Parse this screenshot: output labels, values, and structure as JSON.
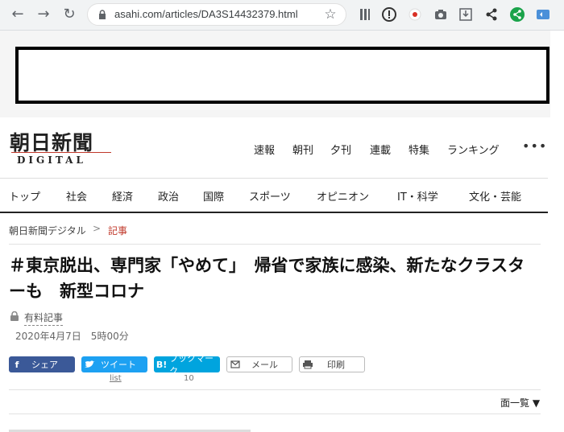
{
  "browser": {
    "url": "asahi.com/articles/DA3S14432379.html",
    "back_icon": "←",
    "forward_icon": "→",
    "reload_icon": "↻",
    "star_icon": "☆"
  },
  "site": {
    "logo_jp": "朝日新聞",
    "logo_en": "DIGITAL",
    "top_nav": [
      "速報",
      "朝刊",
      "夕刊",
      "連載",
      "特集",
      "ランキング"
    ],
    "more_icon": "•••",
    "categories": [
      "トップ",
      "社会",
      "経済",
      "政治",
      "国際",
      "スポーツ",
      "オピニオン",
      "IT・科学",
      "文化・芸能"
    ]
  },
  "breadcrumb": {
    "home": "朝日新聞デジタル",
    "separator": ">",
    "current": "記事"
  },
  "article": {
    "headline": "＃東京脱出、専門家「やめて」　帰省で家族に感染、新たなクラスターも　新型コロナ",
    "paid_label": "有料記事",
    "date": "2020年4月7日　5時00分"
  },
  "share": {
    "share_label": "シェア",
    "share_icon": "f",
    "tweet_label": "ツイート",
    "tweet_count": "list",
    "hatena_label": "ブックマーク",
    "hatena_icon": "B!",
    "hatena_count": "10",
    "mail_label": "メール",
    "print_label": "印刷"
  },
  "list_toggle": "面一覧 ▼",
  "colors": {
    "accent": "#c0392b",
    "facebook": "#3b5998",
    "twitter": "#1da1f2",
    "hatena": "#00a4de"
  }
}
